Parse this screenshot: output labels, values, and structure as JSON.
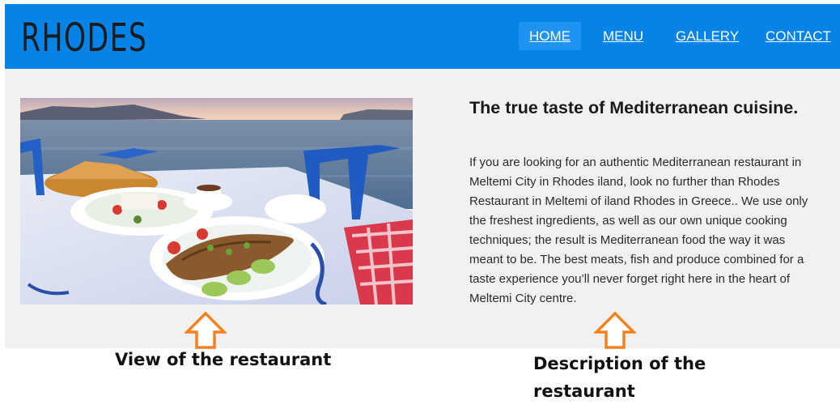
{
  "header": {
    "logo": "RHODES",
    "nav": [
      {
        "label": "HOME",
        "active": true
      },
      {
        "label": "MENU",
        "active": false
      },
      {
        "label": "GALLERY",
        "active": false
      },
      {
        "label": "CONTACT",
        "active": false
      }
    ]
  },
  "main": {
    "image_description_icon": "restaurant-photo",
    "heading": "The true taste of Mediterranean cuisine.",
    "description": "If you are looking for an authentic Mediterranean restaurant in Meltemi City in Rhodes iland, look no further than Rhodes Restaurant in Meltemi of iland Rhodes in Greece.. We use only the freshest ingredients, as well as our own unique cooking techniques; the result is Mediterranean food the way it was meant to be. The best meats, fish and produce combined for a taste experience you’ll never forget right here in the heart of Meltemi City centre."
  },
  "annotations": {
    "left": "View of the restaurant",
    "right": "Description of the restaurant",
    "arrow_color": "#f58220"
  },
  "colors": {
    "nav_background": "#0583e6",
    "nav_active": "#1e93f2",
    "content_background": "#f1f1f1"
  }
}
